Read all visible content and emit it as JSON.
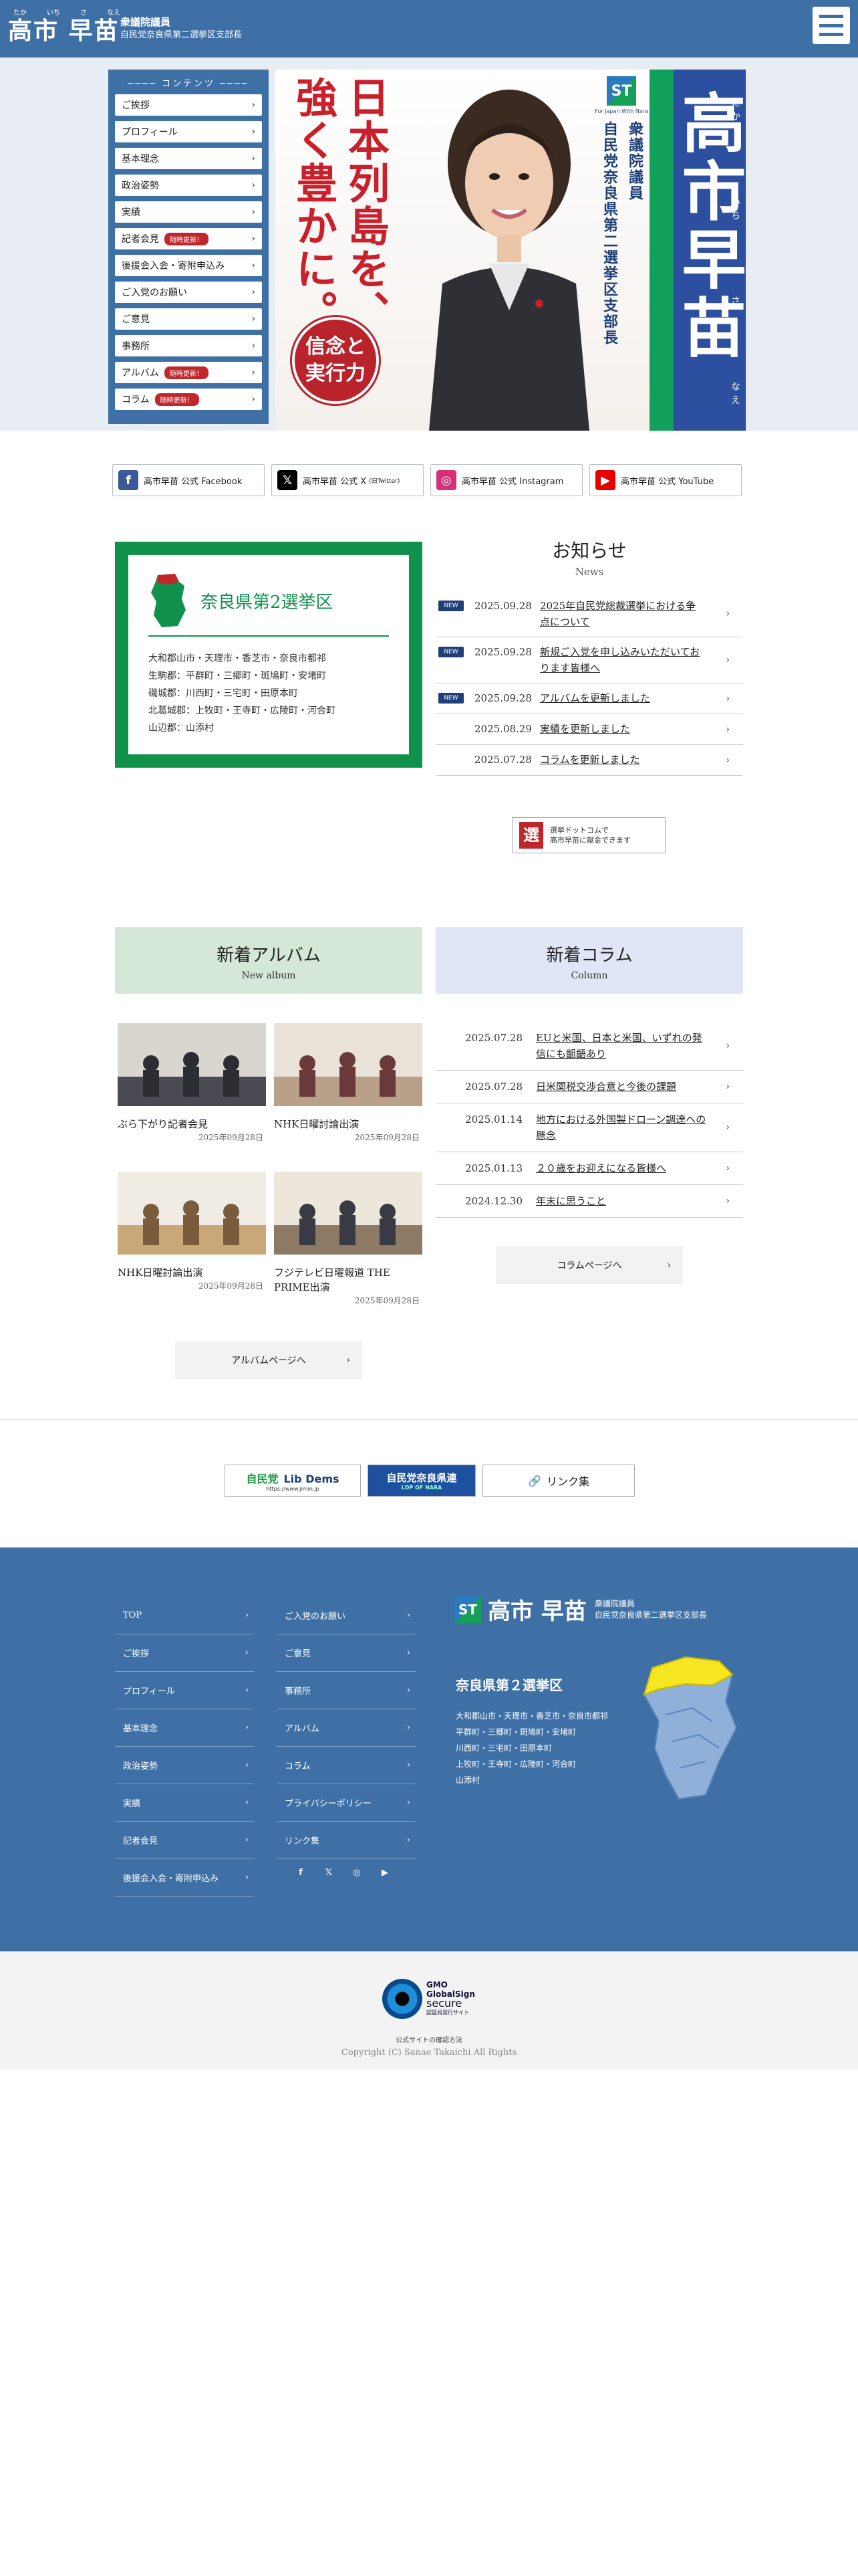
{
  "header": {
    "ruby": [
      "たか",
      "いち",
      "さ",
      "なえ"
    ],
    "name": "高市 早苗",
    "sub1": "衆議院議員",
    "sub2": "自民党奈良県第二選挙区支部長"
  },
  "sidebar": {
    "title": "コンテンツ",
    "items": [
      {
        "label": "ご挨拶",
        "badge": ""
      },
      {
        "label": "プロフィール",
        "badge": ""
      },
      {
        "label": "基本理念",
        "badge": ""
      },
      {
        "label": "政治姿勢",
        "badge": ""
      },
      {
        "label": "実績",
        "badge": ""
      },
      {
        "label": "記者会見",
        "badge": "随時更新！"
      },
      {
        "label": "後援会入会・寄附申込み",
        "badge": ""
      },
      {
        "label": "ご入党のお願い",
        "badge": ""
      },
      {
        "label": "ご意見",
        "badge": ""
      },
      {
        "label": "事務所",
        "badge": ""
      },
      {
        "label": "アルバム",
        "badge": "随時更新！"
      },
      {
        "label": "コラム",
        "badge": "随時更新！"
      }
    ]
  },
  "hero": {
    "slogan_col1": "日本列島を、",
    "slogan_col2": "強く豊かに。",
    "seal_line1": "信念と",
    "seal_line2": "実行力",
    "st_mark": "ST",
    "st_caption": "For Japan With Nara",
    "vert_line1": "衆議院議員",
    "vert_line2": "自民党奈良県第二選挙区支部長",
    "big_name": "高市早苗",
    "name_ruby": [
      "たか",
      "いち",
      "さ",
      "なえ"
    ]
  },
  "social": [
    {
      "label": "高市早苗 公式 Facebook",
      "icon": "f",
      "color": "#3b5998",
      "small": ""
    },
    {
      "label": "高市早苗 公式 X",
      "icon": "𝕏",
      "color": "#000000",
      "small": "(旧Twitter)"
    },
    {
      "label": "高市早苗 公式 Instagram",
      "icon": "◎",
      "color": "#d6307a",
      "small": ""
    },
    {
      "label": "高市早苗 公式 YouTube",
      "icon": "▶",
      "color": "#e60000",
      "small": ""
    }
  ],
  "district": {
    "title": "奈良県第2選挙区",
    "lines": [
      "大和郡山市・天理市・香芝市・奈良市都祁",
      "生駒郡：平群町・三郷町・斑鳩町・安堵町",
      "磯城郡：川西町・三宅町・田原本町",
      "北葛城郡：上牧町・王寺町・広陵町・河合町",
      "山辺郡：山添村"
    ]
  },
  "news": {
    "title": "お知らせ",
    "subtitle": "News",
    "new_label": "NEW",
    "items": [
      {
        "new": true,
        "date": "2025.09.28",
        "title": "2025年自民党総裁選挙における争点について"
      },
      {
        "new": true,
        "date": "2025.09.28",
        "title": "新規ご入党を申し込みいただいております皆様へ"
      },
      {
        "new": true,
        "date": "2025.09.28",
        "title": "アルバムを更新しました"
      },
      {
        "new": false,
        "date": "2025.08.29",
        "title": "実績を更新しました"
      },
      {
        "new": false,
        "date": "2025.07.28",
        "title": "コラムを更新しました"
      }
    ]
  },
  "senkyo": {
    "mark": "選",
    "line1": "選挙ドットコムで",
    "line2": "高市早苗に献金できます"
  },
  "album": {
    "title": "新着アルバム",
    "subtitle": "New album",
    "items": [
      {
        "caption": "ぶら下がり記者会見",
        "date": "2025年09月28日"
      },
      {
        "caption": "NHK日曜討論出演",
        "date": "2025年09月28日"
      },
      {
        "caption": "NHK日曜討論出演",
        "date": "2025年09月28日"
      },
      {
        "caption": "フジテレビ日曜報道 THE PRIME出演",
        "date": "2025年09月28日"
      }
    ],
    "button": "アルバムページへ"
  },
  "column": {
    "title": "新着コラム",
    "subtitle": "Column",
    "items": [
      {
        "date": "2025.07.28",
        "title": "EUと米国、日本と米国、いずれの発信にも齟齬あり"
      },
      {
        "date": "2025.07.28",
        "title": "日米関税交渉合意と今後の課題"
      },
      {
        "date": "2025.01.14",
        "title": "地方における外国製ドローン調達への懸念"
      },
      {
        "date": "2025.01.13",
        "title": "２０歳をお迎えになる皆様へ"
      },
      {
        "date": "2024.12.30",
        "title": "年末に思うこと"
      }
    ],
    "button": "コラムページへ"
  },
  "links": {
    "jimin_top": "自民党",
    "jimin_brand": "Lib Dems",
    "jimin_url": "https://www.jimin.jp",
    "nara_label": "自民党奈良県連",
    "nara_small": "LDP OF NARA",
    "list_label": "リンク集"
  },
  "footer": {
    "nav_left": [
      "TOP",
      "ご挨拶",
      "プロフィール",
      "基本理念",
      "政治姿勢",
      "実績",
      "記者会見",
      "後援会入会・寄附申込み"
    ],
    "nav_right": [
      "ご入党のお願い",
      "ご意見",
      "事務所",
      "アルバム",
      "コラム",
      "プライバシーポリシー",
      "リンク集"
    ],
    "social_icons": [
      "f",
      "𝕏",
      "◎",
      "▶"
    ],
    "logo_mark": "ST",
    "logo_name": "高市 早苗",
    "logo_sub1": "衆議院議員",
    "logo_sub2": "自民党奈良県第二選挙区支部長",
    "district_title": "奈良県第２選挙区",
    "district_lines": [
      "大和郡山市・天理市・香芝市・奈良市都祁",
      "平群町・三郷町・斑鳩町・安堵町",
      "川西町・三宅町・田原本町",
      "上牧町・王寺町・広陵町・河合町",
      "山添村"
    ]
  },
  "bottom": {
    "gmo_brand": "GMO",
    "gmo_line1": "GlobalSign",
    "gmo_line2": "secure",
    "gmo_badge": "認証局発行サイト",
    "gmo_caption": "公式サイトの確認方法",
    "copyright": "Copyright (C) Sanae Takaichi All Rights"
  },
  "colors": {
    "brand_blue": "#3e70a6",
    "party_green": "#11924c",
    "accent_red": "#c0272d"
  }
}
